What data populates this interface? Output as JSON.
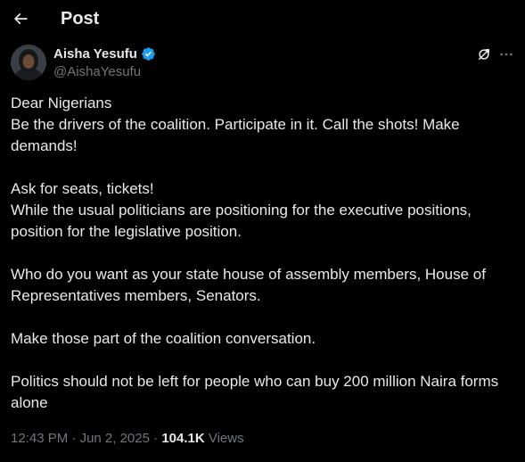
{
  "header": {
    "title": "Post"
  },
  "author": {
    "name": "Aisha Yesufu",
    "handle": "@AishaYesufu",
    "verified_color": "#1d9bf0"
  },
  "post": {
    "paragraphs": [
      [
        "Dear Nigerians",
        "Be the drivers of the coalition. Participate in it. Call the shots! Make demands!"
      ],
      [
        "Ask for seats, tickets!",
        "While the usual politicians are positioning for the executive positions, position for the legislative position."
      ],
      [
        "Who do you want as your state house of assembly members, House of Representatives members, Senators."
      ],
      [
        "Make those part of the coalition conversation."
      ],
      [
        "Politics should not be left for people who can buy 200 million Naira forms alone"
      ]
    ]
  },
  "meta": {
    "time": "12:43 PM",
    "separator": "·",
    "date": "Jun 2, 2025",
    "views_count": "104.1K",
    "views_label": "Views"
  },
  "icons": {
    "back": "arrow-left-icon",
    "verified": "verified-badge-icon",
    "grok": "grok-icon",
    "more": "more-horizontal-icon"
  }
}
